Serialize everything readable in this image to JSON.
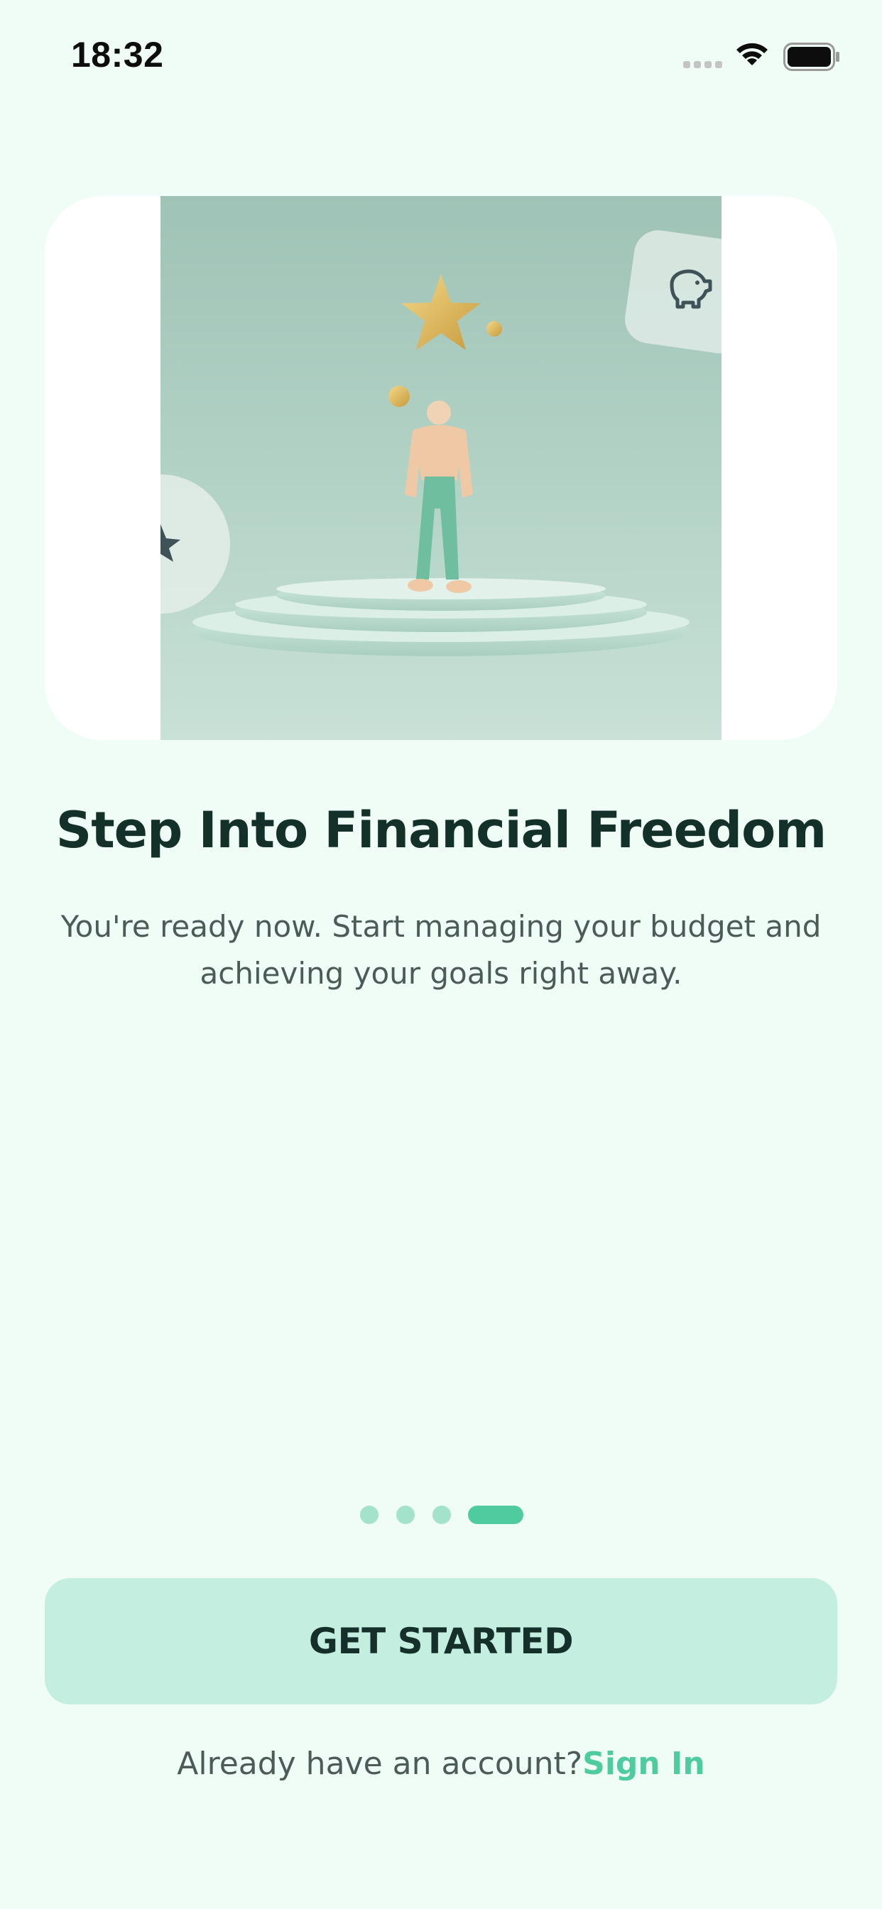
{
  "status_bar": {
    "time": "18:32",
    "icons": [
      "signal-icon",
      "wifi-icon",
      "battery-icon"
    ]
  },
  "hero": {
    "image_description": "",
    "icons": [
      "star-icon",
      "piggy-bank-icon"
    ]
  },
  "onboarding": {
    "title": "Step Into Financial Freedom",
    "subtitle": "You're ready now. Start managing your budget and achieving your goals right away.",
    "page_count": 4,
    "current_page": 4
  },
  "actions": {
    "primary_label": "GET STARTED",
    "signin_prompt": "Already have an account?",
    "signin_link": "Sign In"
  },
  "colors": {
    "background": "#f0fdf6",
    "accent": "#4fcc9f",
    "button_bg": "#c3eee0",
    "title": "#133029",
    "body_text": "#4b5c58"
  }
}
